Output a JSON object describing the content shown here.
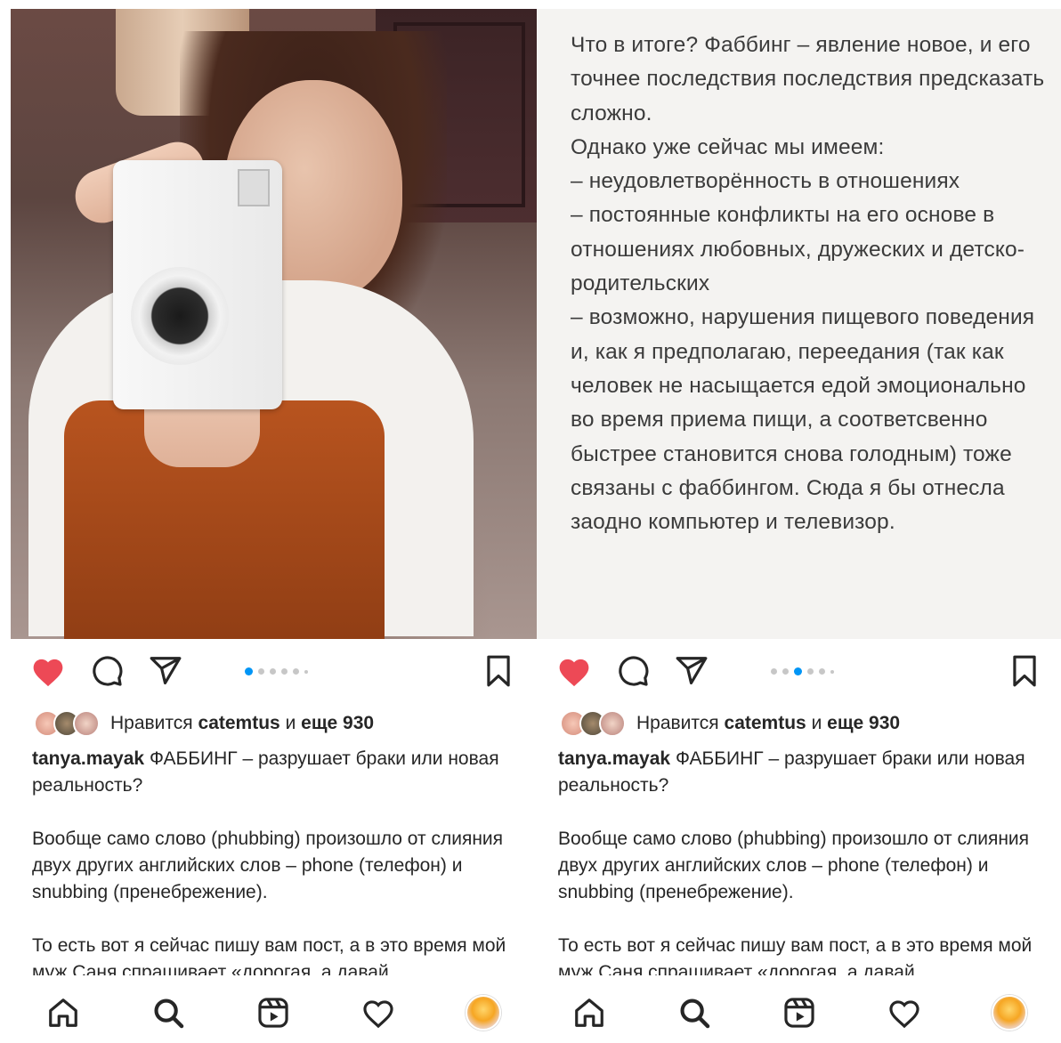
{
  "left_post": {
    "likes": {
      "prefix": "Нравится",
      "user": "catemtus",
      "joiner": "и",
      "count_label": "еще 930"
    },
    "caption": {
      "username": "tanya.mayak",
      "title": "ФАББИНГ – разрушает браки или новая реальность?",
      "paragraph_1": "Вообще само слово (phubbing) произошло от слияния двух других английских слов – phone (телефон) и snubbing (пренебрежение).",
      "paragraph_2": "То есть вот я сейчас пишу вам пост, а в это время мой муж Саня спрашивает «дорогая, а давай"
    },
    "carousel": {
      "count": 6,
      "active_index": 0
    }
  },
  "right_post": {
    "slide_text": "Что в итоге? Фаббинг – явление новое, и его точнее последствия последствия предсказать сложно.\nОднако уже сейчас мы имеем:\n– неудовлетворённость в отношениях\n– постоянные конфликты на его основе в отношениях любовных, дружеских и детско-родительских\n– возможно, нарушения пищевого поведения и, как я предполагаю, переедания (так как человек не насыщается едой эмоционально во время приема пищи, а соответсвенно быстрее становится снова голодным) тоже связаны с фаббингом. Сюда я бы отнесла заодно компьютер и телевизор.",
    "likes": {
      "prefix": "Нравится",
      "user": "catemtus",
      "joiner": "и",
      "count_label": "еще 930"
    },
    "caption": {
      "username": "tanya.mayak",
      "title": "ФАББИНГ – разрушает браки или новая реальность?",
      "paragraph_1": "Вообще само слово (phubbing) произошло от слияния двух других английских слов – phone (телефон) и snubbing (пренебрежение).",
      "paragraph_2": "То есть вот я сейчас пишу вам пост, а в это время мой муж Саня спрашивает «дорогая, а давай"
    },
    "carousel": {
      "count": 6,
      "active_index": 2
    }
  },
  "icons": {
    "like": "heart-filled-icon",
    "comment": "comment-icon",
    "share": "send-icon",
    "save": "bookmark-icon",
    "nav": [
      "home-icon",
      "search-icon",
      "reels-icon",
      "activity-heart-icon",
      "profile-avatar"
    ]
  },
  "colors": {
    "like_red": "#ed4956",
    "carousel_active": "#0095f6",
    "text": "#262626"
  }
}
